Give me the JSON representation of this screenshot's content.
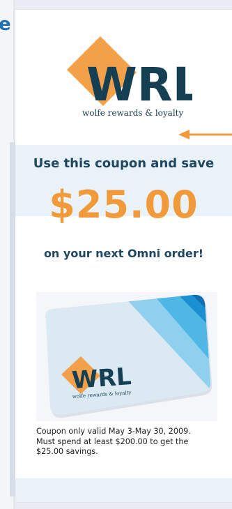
{
  "page": {
    "partial_letter": "e"
  },
  "logo": {
    "letters": "WRL",
    "tagline": "wolfe rewards & loyalty"
  },
  "coupon": {
    "headline": "Use this coupon and save",
    "amount": "$25.00",
    "subline": "on your next Omni order!"
  },
  "card": {
    "letters": "WRL",
    "tagline": "wolfe rewards & loyalty"
  },
  "terms": {
    "line1": "Coupon only valid May 3-May 30, 2009.",
    "line2": "Must spend at least $200.00 to get the",
    "line3": "$25.00 savings."
  },
  "colors": {
    "accent_orange": "#f09a3c",
    "navy": "#1f4760",
    "teal_dark": "#153f52",
    "light_blue": "#e8f1f9"
  }
}
